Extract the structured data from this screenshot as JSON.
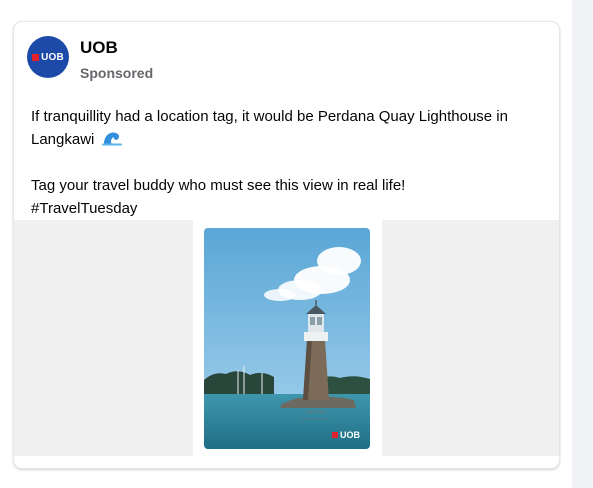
{
  "post": {
    "page_name": "UOB",
    "sponsored_label": "Sponsored",
    "avatar_logo_text": "UOB",
    "text_line1": "If tranquillity had a location tag, it would be Perdana Quay Lighthouse in Langkawi",
    "wave_emoji_icon": "water-wave-icon",
    "text_line2": "Tag your travel buddy who must see this view in real life!",
    "hashtag": "#TravelTuesday",
    "image_watermark": "UOB"
  },
  "colors": {
    "brand_blue": "#1d4aa8",
    "brand_red": "#e3202c",
    "secondary_text": "#65676b"
  }
}
